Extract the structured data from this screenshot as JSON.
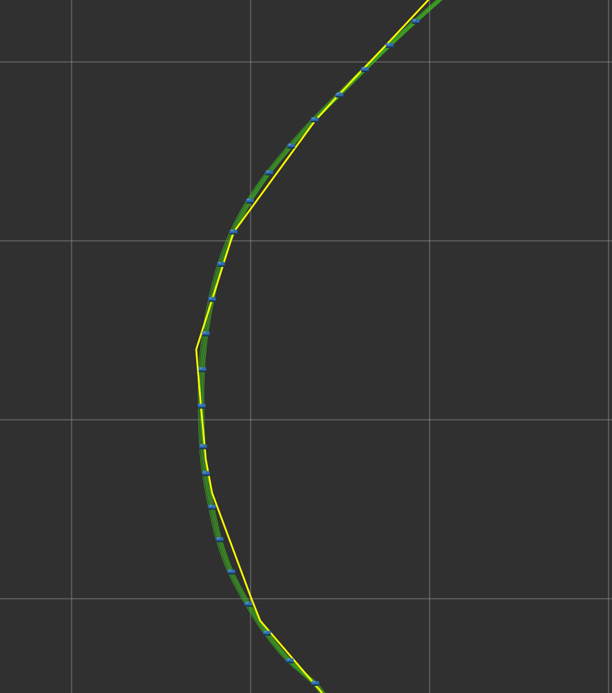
{
  "view": {
    "background_color": "#303030",
    "grid_color": "#9a9a9a"
  },
  "path_display": {
    "planned_path_color": "#ffff00",
    "candidate_path_color": "#3fbf1f",
    "waypoint_color": "#2f6fb0",
    "waypoint_icon": "waypoint-marker"
  }
}
